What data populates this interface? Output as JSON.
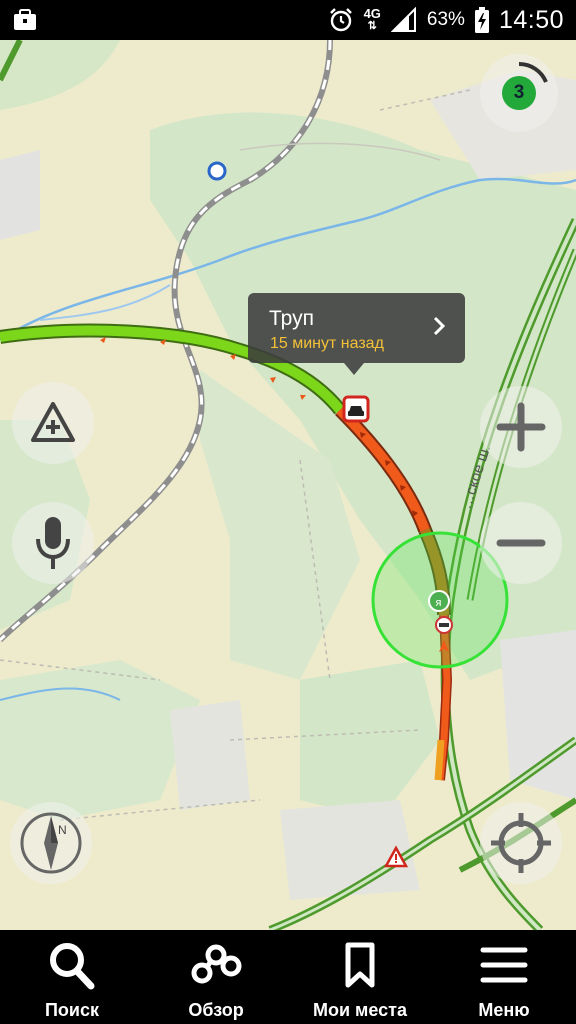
{
  "status_bar": {
    "network": "4G",
    "battery_percent": "63%",
    "time": "14:50",
    "icons": [
      "bag-icon",
      "alarm-icon",
      "signal-icon",
      "battery-charging-icon"
    ]
  },
  "map": {
    "traffic_level": "3",
    "callout": {
      "title": "Труп",
      "subtitle": "15 минут назад"
    },
    "road_label": "…ское ш.",
    "buttons": [
      "report-event-button",
      "voice-search-button",
      "zoom-in-button",
      "zoom-out-button",
      "compass-button",
      "locate-me-button"
    ],
    "colors": {
      "route_green": "#7cd61a",
      "route_red": "#f05a1a",
      "route_orange": "#f0a020",
      "location_circle": "#36e236",
      "water": "#7ab6e8",
      "forest": "#d3e5c6"
    }
  },
  "nav": {
    "items": [
      {
        "label": "Поиск",
        "icon": "search-icon"
      },
      {
        "label": "Обзор",
        "icon": "overview-icon"
      },
      {
        "label": "Мои места",
        "icon": "bookmark-icon"
      },
      {
        "label": "Меню",
        "icon": "menu-icon"
      }
    ]
  }
}
